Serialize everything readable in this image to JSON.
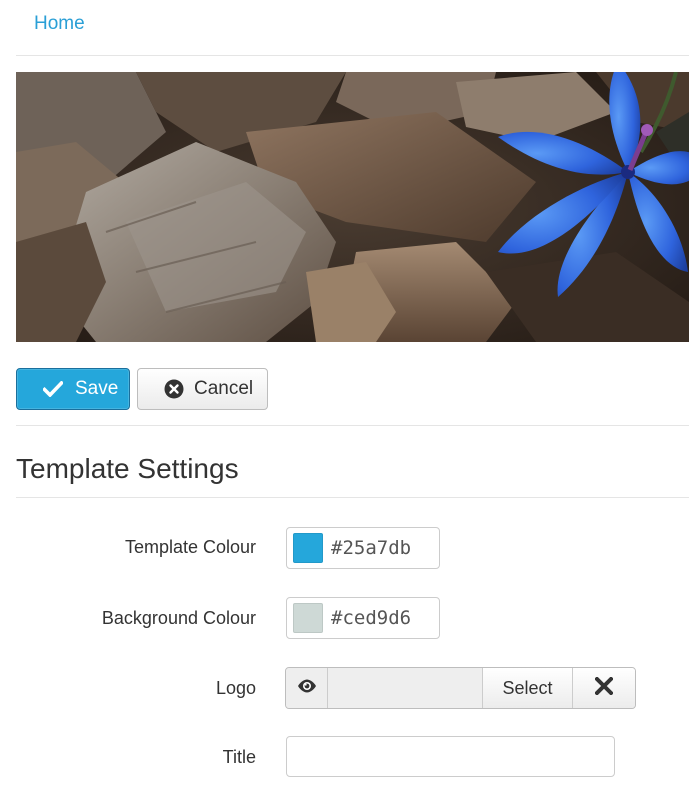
{
  "breadcrumb": {
    "home_label": "Home"
  },
  "hero": {
    "image_icon": "flower-on-leaves-image"
  },
  "toolbar": {
    "save_label": "Save",
    "save_icon": "checkmark-icon",
    "cancel_label": "Cancel",
    "cancel_icon": "circle-x-icon"
  },
  "section": {
    "title": "Template Settings"
  },
  "form": {
    "template_colour": {
      "label": "Template Colour",
      "value": "#25a7db"
    },
    "background_colour": {
      "label": "Background Colour",
      "value": "#ced9d6"
    },
    "logo": {
      "label": "Logo",
      "preview_icon": "eye-icon",
      "value": "",
      "select_label": "Select",
      "clear_icon": "close-icon"
    },
    "title": {
      "label": "Title",
      "value": ""
    }
  },
  "colors": {
    "accent": "#25a7db",
    "link": "#2a9fd6",
    "background_swatch": "#ced9d6"
  }
}
